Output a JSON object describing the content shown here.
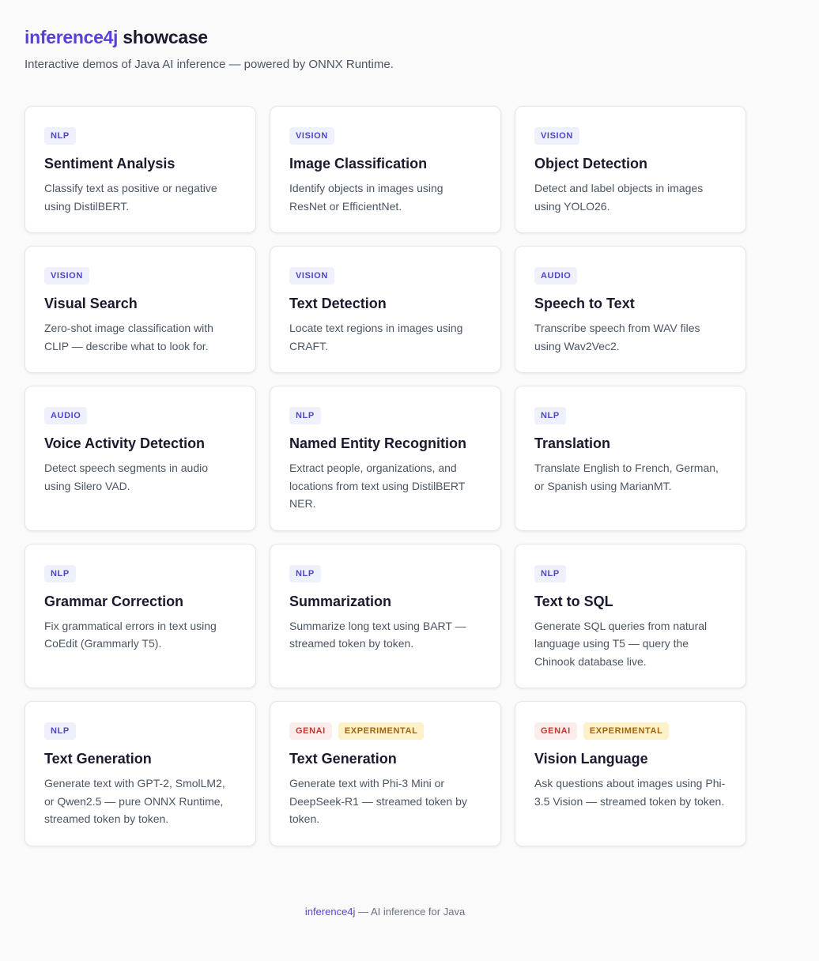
{
  "header": {
    "brand": "inference4j",
    "title_rest": "showcase",
    "subtitle": "Interactive demos of Java AI inference — powered by ONNX Runtime."
  },
  "cards": [
    {
      "name": "sentiment-analysis",
      "tags": [
        "NLP"
      ],
      "title": "Sentiment Analysis",
      "desc": "Classify text as positive or negative using DistilBERT."
    },
    {
      "name": "image-classification",
      "tags": [
        "VISION"
      ],
      "title": "Image Classification",
      "desc": "Identify objects in images using ResNet or EfficientNet."
    },
    {
      "name": "object-detection",
      "tags": [
        "VISION"
      ],
      "title": "Object Detection",
      "desc": "Detect and label objects in images using YOLO26."
    },
    {
      "name": "visual-search",
      "tags": [
        "VISION"
      ],
      "title": "Visual Search",
      "desc": "Zero-shot image classification with CLIP — describe what to look for."
    },
    {
      "name": "text-detection",
      "tags": [
        "VISION"
      ],
      "title": "Text Detection",
      "desc": "Locate text regions in images using CRAFT."
    },
    {
      "name": "speech-to-text",
      "tags": [
        "AUDIO"
      ],
      "title": "Speech to Text",
      "desc": "Transcribe speech from WAV files using Wav2Vec2."
    },
    {
      "name": "voice-activity-detection",
      "tags": [
        "AUDIO"
      ],
      "title": "Voice Activity Detection",
      "desc": "Detect speech segments in audio using Silero VAD."
    },
    {
      "name": "named-entity-recognition",
      "tags": [
        "NLP"
      ],
      "title": "Named Entity Recognition",
      "desc": "Extract people, organizations, and locations from text using DistilBERT NER."
    },
    {
      "name": "translation",
      "tags": [
        "NLP"
      ],
      "title": "Translation",
      "desc": "Translate English to French, German, or Spanish using MarianMT."
    },
    {
      "name": "grammar-correction",
      "tags": [
        "NLP"
      ],
      "title": "Grammar Correction",
      "desc": "Fix grammatical errors in text using CoEdit (Grammarly T5)."
    },
    {
      "name": "summarization",
      "tags": [
        "NLP"
      ],
      "title": "Summarization",
      "desc": "Summarize long text using BART — streamed token by token."
    },
    {
      "name": "text-to-sql",
      "tags": [
        "NLP"
      ],
      "title": "Text to SQL",
      "desc": "Generate SQL queries from natural language using T5 — query the Chinook database live."
    },
    {
      "name": "text-generation-nlp",
      "tags": [
        "NLP"
      ],
      "title": "Text Generation",
      "desc": "Generate text with GPT-2, SmolLM2, or Qwen2.5 — pure ONNX Runtime, streamed token by token."
    },
    {
      "name": "text-generation-genai",
      "tags": [
        "GENAI",
        "EXPERIMENTAL"
      ],
      "title": "Text Generation",
      "desc": "Generate text with Phi-3 Mini or DeepSeek-R1 — streamed token by token."
    },
    {
      "name": "vision-language",
      "tags": [
        "GENAI",
        "EXPERIMENTAL"
      ],
      "title": "Vision Language",
      "desc": "Ask questions about images using Phi-3.5 Vision — streamed token by token."
    }
  ],
  "footer": {
    "link": "inference4j",
    "text": " — AI inference for Java"
  },
  "colors": {
    "brand": "#5b3fd9",
    "tag_category": "#4f46c9",
    "tag_genai": "#c8352e",
    "tag_experimental": "#a36410"
  }
}
